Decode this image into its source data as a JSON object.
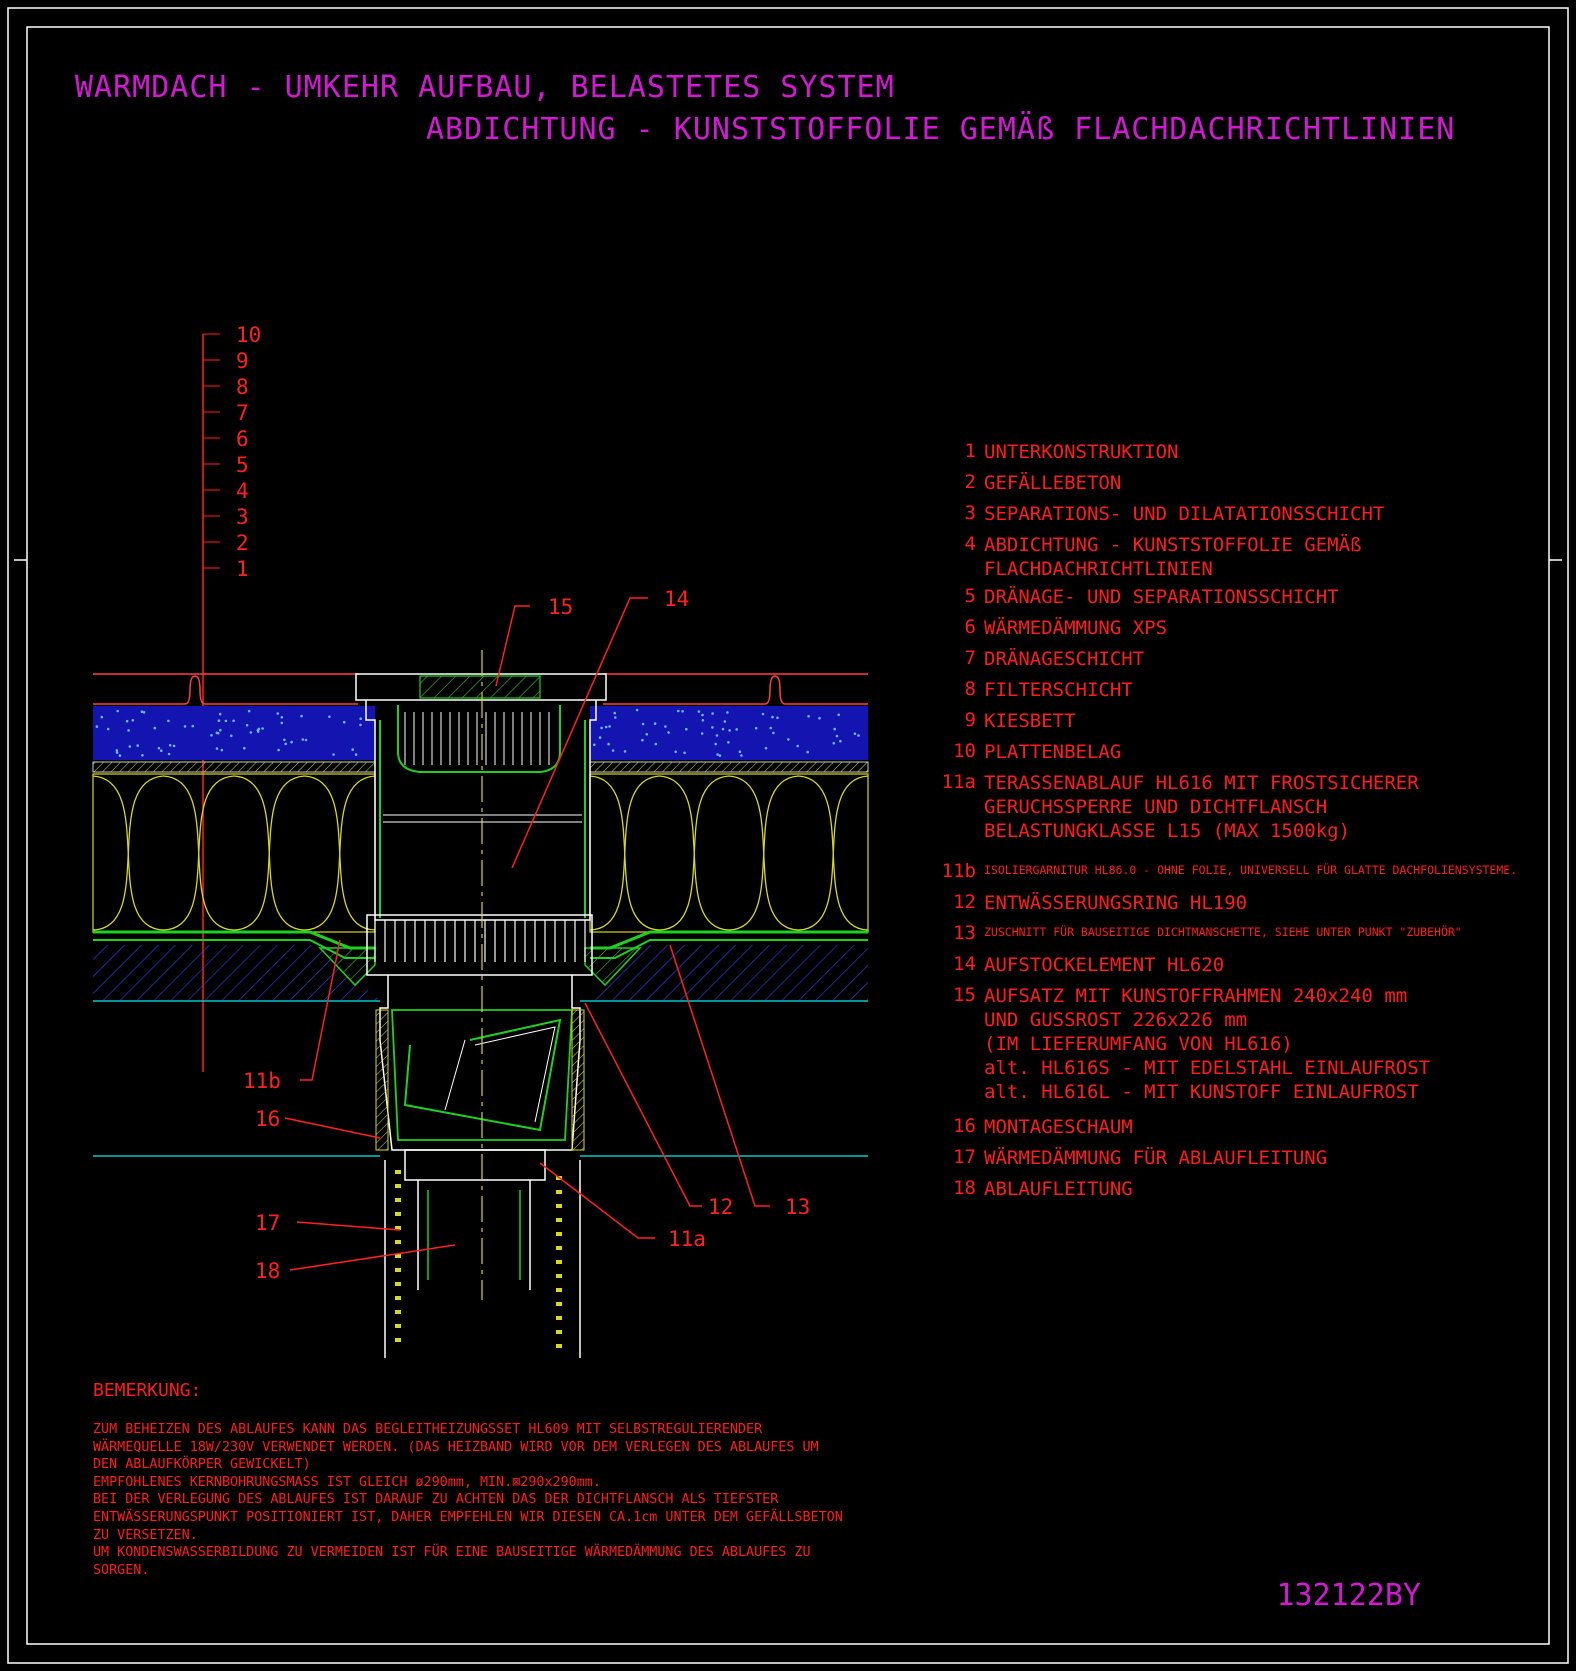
{
  "titles": {
    "line1": "WARMDACH - UMKEHR AUFBAU, BELASTETES SYSTEM",
    "line2": "ABDICHTUNG - KUNSTSTOFFOLIE GEMÄß FLACHDACHRICHTLINIEN"
  },
  "layer_scale": [
    "10",
    "9",
    "8",
    "7",
    "6",
    "5",
    "4",
    "3",
    "2",
    "1"
  ],
  "callouts": {
    "c15": "15",
    "c14": "14",
    "c11b": "11b",
    "c16": "16",
    "c17": "17",
    "c18": "18",
    "c12": "12",
    "c13": "13",
    "c11a": "11a"
  },
  "legend": [
    {
      "num": "1",
      "text": "UNTERKONSTRUKTION"
    },
    {
      "num": "2",
      "text": "GEFÄLLEBETON"
    },
    {
      "num": "3",
      "text": "SEPARATIONS- UND DILATATIONSSCHICHT"
    },
    {
      "num": "4",
      "text": "ABDICHTUNG - KUNSTSTOFFOLIE GEMÄß\nFLACHDACHRICHTLINIEN"
    },
    {
      "num": "5",
      "text": "DRÄNAGE- UND SEPARATIONSSCHICHT"
    },
    {
      "num": "6",
      "text": "WÄRMEDÄMMUNG XPS"
    },
    {
      "num": "7",
      "text": "DRÄNAGESCHICHT"
    },
    {
      "num": "8",
      "text": "FILTERSCHICHT"
    },
    {
      "num": "9",
      "text": "KIESBETT"
    },
    {
      "num": "10",
      "text": "PLATTENBELAG"
    },
    {
      "num": "11a",
      "text": "TERASSENABLAUF HL616 MIT FROSTSICHERER\nGERUCHSSPERRE UND DICHTFLANSCH\nBELASTUNGKLASSE L15 (MAX 1500kg)"
    },
    {
      "num": "11b",
      "text": "ISOLIERGARNITUR HL86.0 - OHNE FOLIE, UNIVERSELL FÜR GLATTE DACHFOLIENSYSTEME.",
      "small": true
    },
    {
      "num": "12",
      "text": "ENTWÄSSERUNGSRING HL190"
    },
    {
      "num": "13",
      "text": "ZUSCHNITT FÜR BAUSEITIGE DICHTMANSCHETTE, SIEHE UNTER PUNKT \"ZUBEHÖR\"",
      "small": true
    },
    {
      "num": "14",
      "text": "AUFSTOCKELEMENT HL620"
    },
    {
      "num": "15",
      "text": "AUFSATZ MIT KUNSTOFFRAHMEN 240x240 mm\nUND GUSSROST 226x226 mm\n(IM LIEFERUMFANG VON HL616)\nalt. HL616S - MIT EDELSTAHL EINLAUFROST\nalt. HL616L - MIT KUNSTOFF EINLAUFROST"
    },
    {
      "num": "16",
      "text": "MONTAGESCHAUM"
    },
    {
      "num": "17",
      "text": "WÄRMEDÄMMUNG FÜR ABLAUFLEITUNG"
    },
    {
      "num": "18",
      "text": "ABLAUFLEITUNG"
    }
  ],
  "remark": {
    "heading": "BEMERKUNG:",
    "lines": [
      "ZUM BEHEIZEN DES ABLAUFES KANN DAS BEGLEITHEIZUNGSSET HL609 MIT SELBSTREGULIERENDER",
      "WÄRMEQUELLE 18W/230V VERWENDET WERDEN. (DAS HEIZBAND WIRD VOR DEM VERLEGEN DES ABLAUFES UM",
      "DEN ABLAUFKÖRPER GEWICKELT)",
      "EMPFOHLENES KERNBOHRUNGSMASS IST GLEICH ø290mm, MIN.⊠290x290mm.",
      "BEI DER VERLEGUNG DES ABLAUFES IST DARAUF ZU ACHTEN DAS DER DICHTFLANSCH ALS TIEFSTER",
      "ENTWÄSSERUNGSPUNKT POSITIONIERT IST, DAHER EMPFEHLEN WIR DIESEN CA.1cm UNTER DEM GEFÄLLSBETON",
      "ZU VERSETZEN.",
      "UM KONDENSWASSERBILDUNG ZU VERMEIDEN IST FÜR EINE BAUSEITIGE WÄRMEDÄMMUNG DES ABLAUFES ZU",
      "SORGEN."
    ]
  },
  "drawing_code": "132122BY",
  "colors": {
    "background": "#000000",
    "frame": "#ffffff",
    "title": "#d21ad2",
    "annotation": "#ff1c1c",
    "gravel": "#1a1ad8",
    "insulation": "#d8d820",
    "membrane": "#20d020",
    "concrete": "#4040ff",
    "level_line": "#00c8c8"
  }
}
